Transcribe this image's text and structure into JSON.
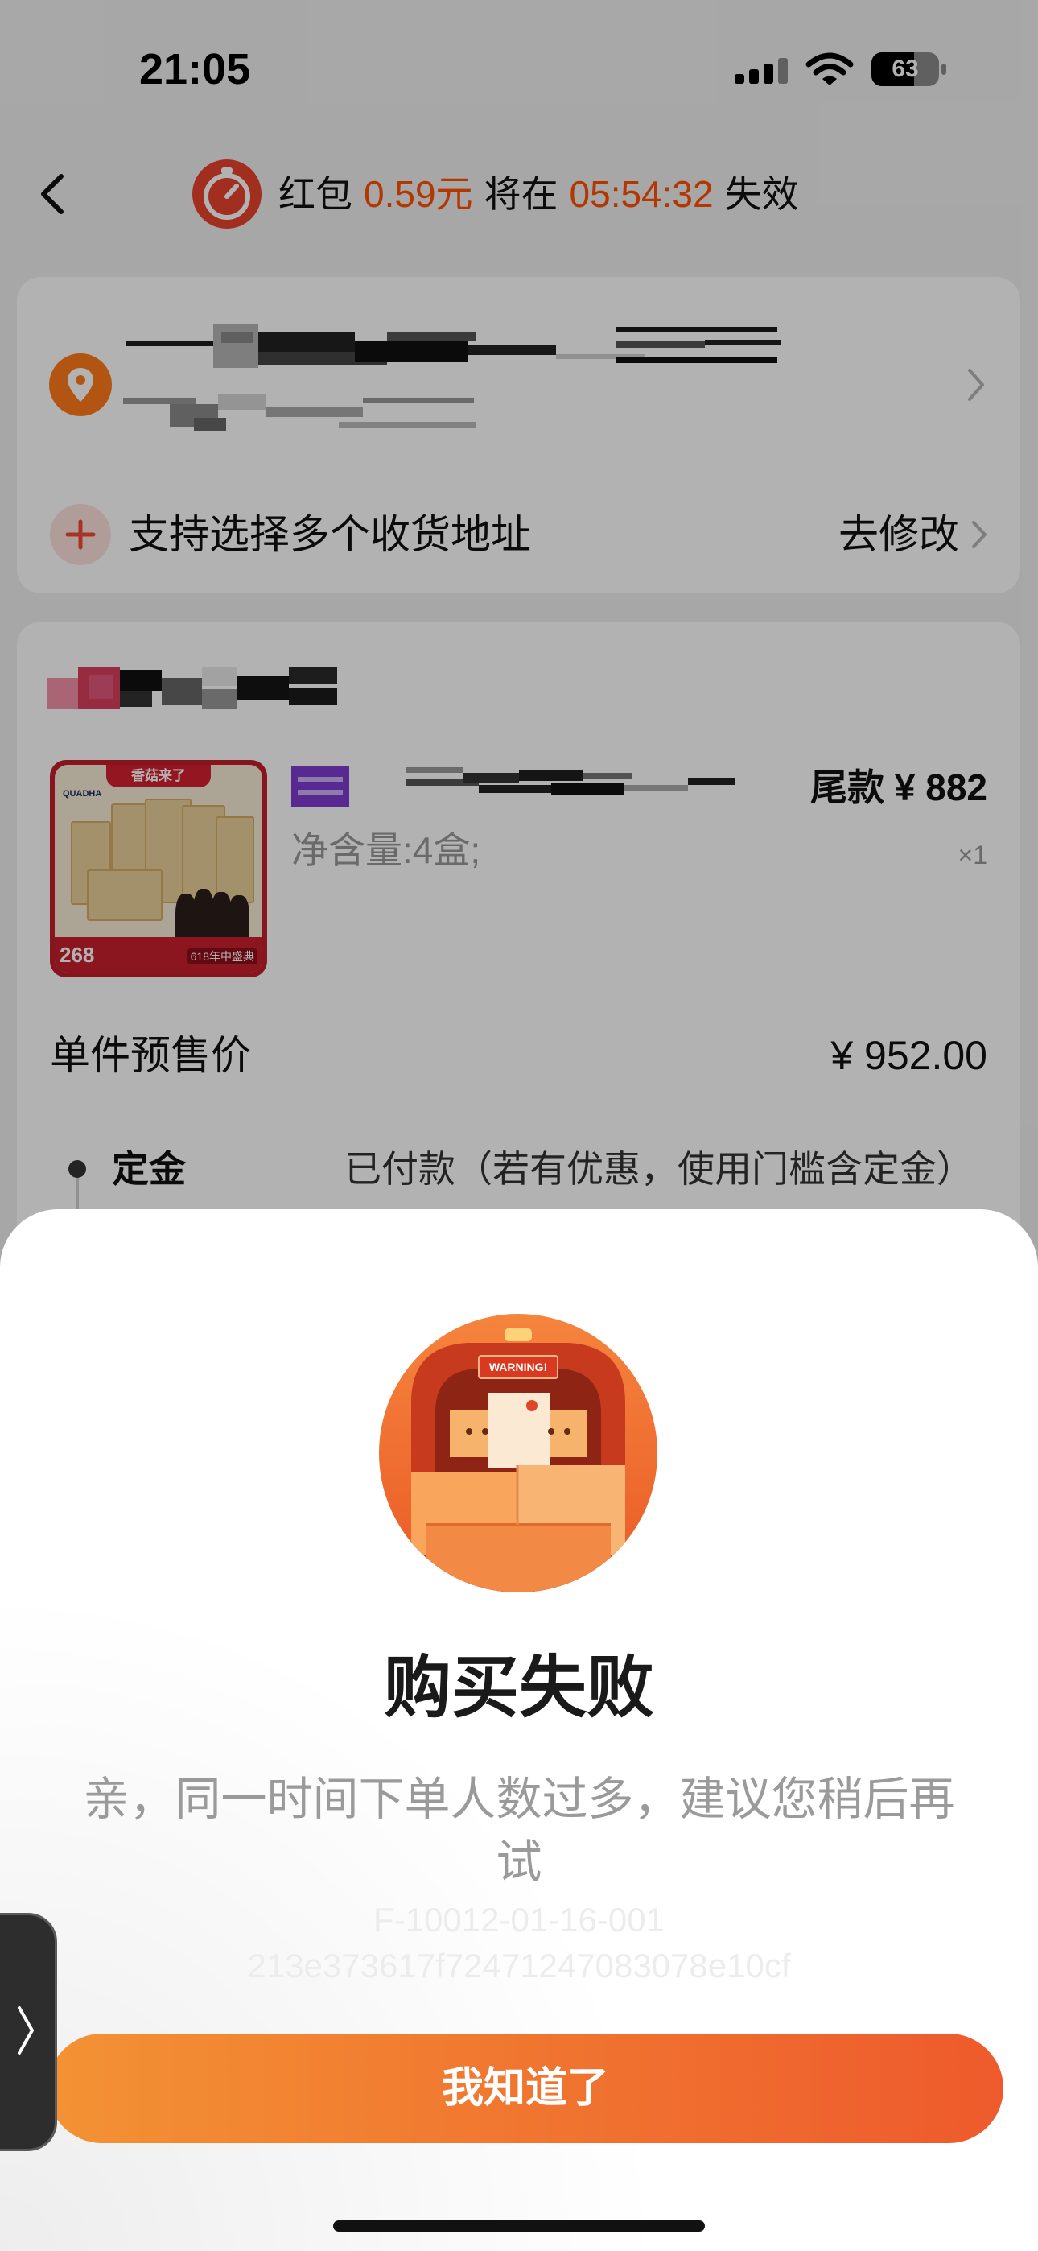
{
  "status_bar": {
    "time": "21:05",
    "battery_level": "63"
  },
  "header": {
    "red_packet_label": "红包",
    "red_packet_amount": "0.59元",
    "expire_prefix": "将在",
    "countdown": "05:54:32",
    "expire_suffix": "失效"
  },
  "address": {
    "multi_address_label": "支持选择多个收货地址",
    "edit_label": "去修改"
  },
  "order": {
    "product": {
      "thumbnail": {
        "banner": "香菇来了",
        "brand": "QUADHA",
        "price": "268",
        "event": "618年中盛典"
      },
      "final_payment_label": "尾款",
      "final_payment_amount": "¥ 882",
      "spec": "净含量:4盒;",
      "quantity": "×1"
    },
    "unit_presale_label": "单件预售价",
    "unit_presale_price": "¥ 952.00",
    "deposit": {
      "label": "定金",
      "status": "已付款（若有优惠，使用门槛含定金）"
    }
  },
  "dialog": {
    "warning_sign": "WARNING!",
    "title": "购买失败",
    "message": "亲，同一时间下单人数过多，建议您稍后再试",
    "error_code": "F-10012-01-16-001",
    "trace_id": "213e373617f72471247083078e10cf",
    "confirm_label": "我知道了"
  },
  "icons": {
    "back": "chevron-left-icon",
    "timer": "timer-icon",
    "location": "location-pin-icon",
    "add": "plus-icon",
    "forward": "chevron-right-icon",
    "illustration": "truck-warning-illustration",
    "side_handle": "chevron-right-icon"
  },
  "colors": {
    "accent": "#ff5000",
    "timer_red": "#e8432f",
    "location_orange": "#ff7a1a",
    "button_start": "#f39234",
    "button_end": "#ee5a2c",
    "message_gray": "#9a9a9a"
  }
}
